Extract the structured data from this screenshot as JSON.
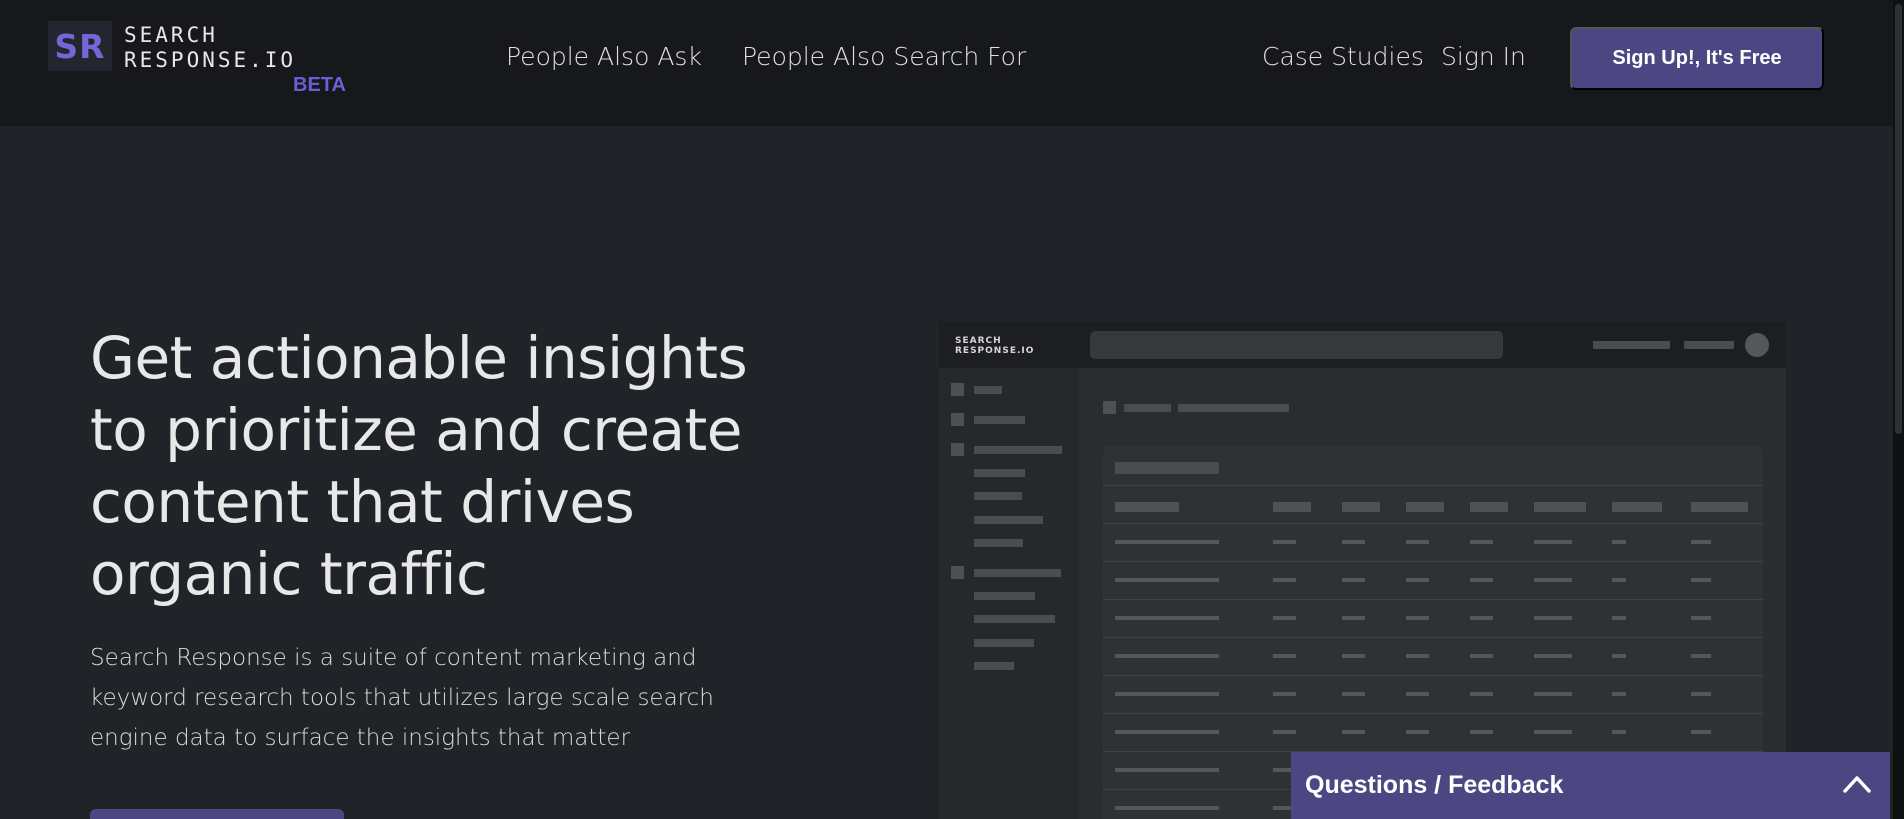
{
  "header": {
    "logo_mark": "SR",
    "logo_line1": "SEARCH",
    "logo_line2": "RESPONSE.IO",
    "beta": "BETA",
    "nav": [
      "People Also Ask",
      "People Also Search For",
      "Case Studies",
      "Sign In"
    ],
    "signup_label": "Sign Up!, It's Free"
  },
  "hero": {
    "title": "Get actionable insights to prioritize and create content that drives organic traffic",
    "subtitle": "Search Response is a suite of content marketing and keyword research tools that utilizes large scale search engine data to surface the insights that matter"
  },
  "mock": {
    "logo_line1": "SEARCH",
    "logo_line2": "RESPONSE.IO"
  },
  "feedback": {
    "label": "Questions / Feedback",
    "icon": "chevron-up-icon"
  },
  "colors": {
    "page_bg": "#202327",
    "header_bg": "#16181b",
    "accent": "#4c4682",
    "beta": "#6c5ed6"
  }
}
